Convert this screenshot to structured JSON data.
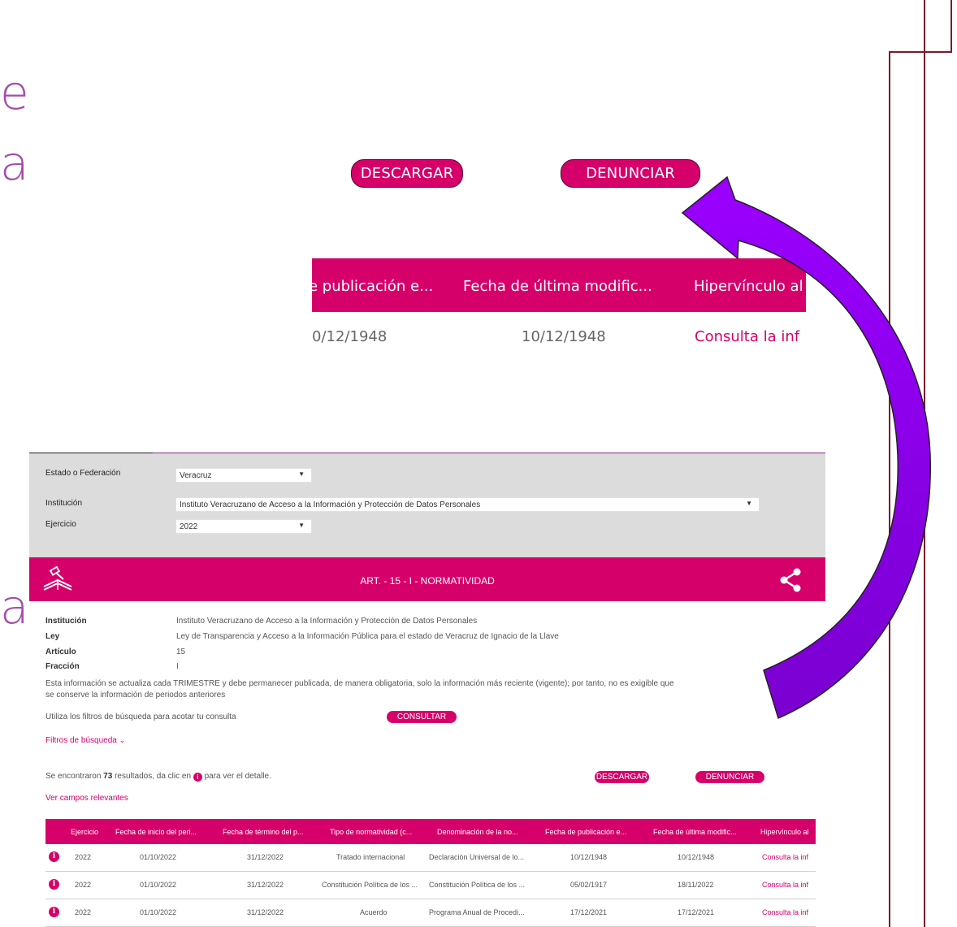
{
  "slide_fragments": {
    "f1": "e",
    "f2": "a",
    "f3": "a"
  },
  "zoom": {
    "descargar": "DESCARGAR",
    "denunciar": "DENUNCIAR",
    "headers": [
      "e publicación e...",
      "Fecha de última modific...",
      "Hipervínculo al"
    ],
    "row": [
      "0/12/1948",
      "10/12/1948",
      "Consulta la inf"
    ]
  },
  "filters": {
    "estado_label": "Estado o Federación",
    "estado_value": "Veracruz",
    "institucion_label": "Institución",
    "institucion_value": "Instituto Veracruzano de Acceso a la Información y Protección de Datos Personales",
    "ejercicio_label": "Ejercicio",
    "ejercicio_value": "2022"
  },
  "band": {
    "title": "ART. - 15 - I - NORMATIVIDAD",
    "left_icon": "gavel-book-icon",
    "right_icon": "share-icon"
  },
  "details": {
    "institucion_label": "Institución",
    "institucion_value": "Instituto Veracruzano de Acceso a la Información y Protección de Datos Personales",
    "ley_label": "Ley",
    "ley_value": "Ley de Transparencia y Acceso a la Información Pública para el estado de Veracruz de Ignacio de la Llave",
    "articulo_label": "Artículo",
    "articulo_value": "15",
    "fraccion_label": "Fracción",
    "fraccion_value": "I",
    "note_line1": "Esta información se actualiza cada TRIMESTRE y debe permanecer publicada, de manera obligatoria, solo la información más reciente (vigente); por tanto, no es exigible que",
    "note_line2": "se conserve la información de periodos anteriores"
  },
  "search": {
    "hint": "Utiliza los filtros de búsqueda para acotar tu consulta",
    "consultar": "CONSULTAR",
    "filtros_link": "Filtros de búsqueda"
  },
  "results": {
    "prefix": "Se encontraron",
    "count": "73",
    "suffix": "resultados, da clic en",
    "suffix2": "para ver el detalle.",
    "descargar": "DESCARGAR",
    "denunciar": "DENUNCIAR",
    "ver_campos": "Ver campos relevantes"
  },
  "table": {
    "headers": [
      "Ejercicio",
      "Fecha de inicio del peri...",
      "Fecha de término del p...",
      "Tipo de normatividad (c...",
      "Denominación de la no...",
      "Fecha de publicación e...",
      "Fecha de última modific...",
      "Hipervínculo al"
    ],
    "rows": [
      [
        "2022",
        "01/10/2022",
        "31/12/2022",
        "Tratado internacional",
        "Declaración Universal de lo...",
        "10/12/1948",
        "10/12/1948",
        "Consulta la inf"
      ],
      [
        "2022",
        "01/10/2022",
        "31/12/2022",
        "Constitución Política de los ...",
        "Constitución Política de los ...",
        "05/02/1917",
        "18/11/2022",
        "Consulta la inf"
      ],
      [
        "2022",
        "01/10/2022",
        "31/12/2022",
        "Acuerdo",
        "Programa Anual de Procedi...",
        "17/12/2021",
        "17/12/2021",
        "Consulta la inf"
      ]
    ]
  },
  "colors": {
    "brand": "#d6006a",
    "arrow": "#8a00ff",
    "frame": "#7a1a2a",
    "slide_text": "#a34fa8"
  }
}
